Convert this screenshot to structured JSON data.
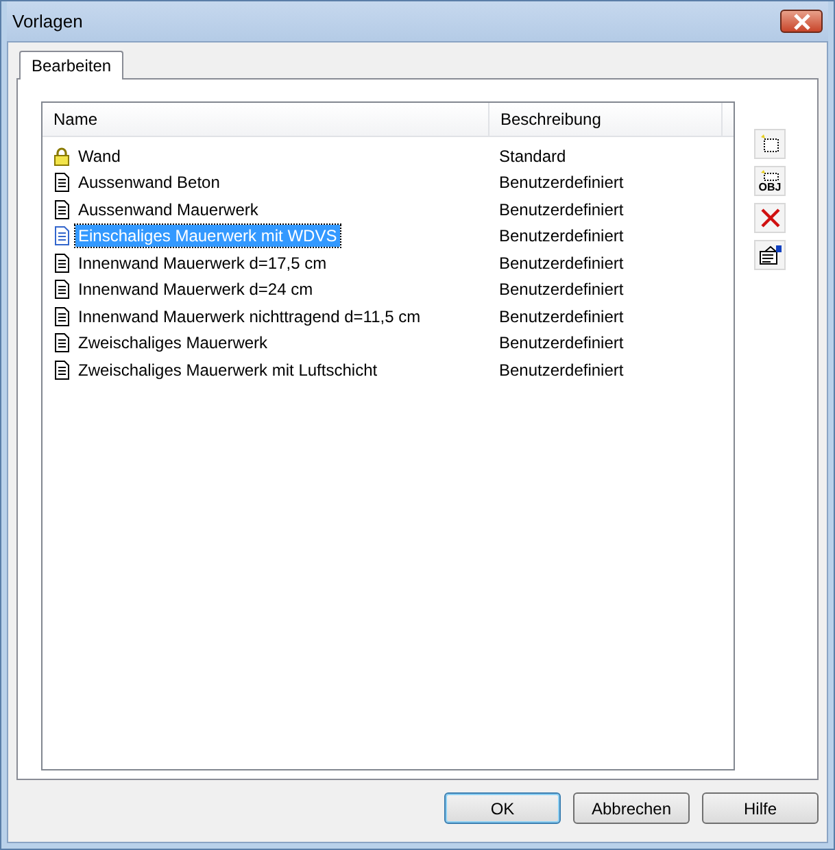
{
  "window": {
    "title": "Vorlagen"
  },
  "tabs": [
    {
      "label": "Bearbeiten",
      "selected": true
    }
  ],
  "table": {
    "columns": [
      "Name",
      "Beschreibung"
    ],
    "rows": [
      {
        "kind": "locked",
        "name": "Wand",
        "description": "Standard",
        "selected": false
      },
      {
        "kind": "document",
        "name": "Aussenwand Beton",
        "description": "Benutzerdefiniert",
        "selected": false
      },
      {
        "kind": "document",
        "name": "Aussenwand Mauerwerk",
        "description": "Benutzerdefiniert",
        "selected": false
      },
      {
        "kind": "document",
        "name": "Einschaliges Mauerwerk mit WDVS",
        "description": "Benutzerdefiniert",
        "selected": true
      },
      {
        "kind": "document",
        "name": "Innenwand Mauerwerk d=17,5 cm",
        "description": "Benutzerdefiniert",
        "selected": false
      },
      {
        "kind": "document",
        "name": "Innenwand Mauerwerk d=24 cm",
        "description": "Benutzerdefiniert",
        "selected": false
      },
      {
        "kind": "document",
        "name": "Innenwand Mauerwerk nichttragend d=11,5 cm",
        "description": "Benutzerdefiniert",
        "selected": false
      },
      {
        "kind": "document",
        "name": "Zweischaliges Mauerwerk",
        "description": "Benutzerdefiniert",
        "selected": false
      },
      {
        "kind": "document",
        "name": "Zweischaliges Mauerwerk mit Luftschicht",
        "description": "Benutzerdefiniert",
        "selected": false
      }
    ]
  },
  "toolbar": [
    {
      "kind": "new"
    },
    {
      "kind": "new_object",
      "label": "OBJ"
    },
    {
      "kind": "delete"
    },
    {
      "kind": "properties"
    }
  ],
  "buttons": [
    {
      "label": "OK",
      "default": true
    },
    {
      "label": "Abbrechen",
      "default": false
    },
    {
      "label": "Hilfe",
      "default": false
    }
  ]
}
